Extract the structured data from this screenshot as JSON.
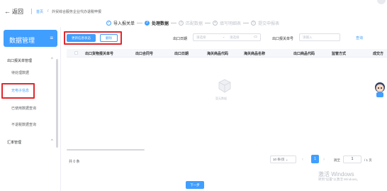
{
  "header": {
    "back_label": "返回",
    "breadcrumb_home": "首页",
    "breadcrumb_separator": "/",
    "breadcrumb_current": "外贸综合服务企业代办退税申报"
  },
  "steps": [
    {
      "number": "✓",
      "label": "导入报关单",
      "state": "done"
    },
    {
      "number": "2",
      "label": "处理数据",
      "state": "active"
    },
    {
      "number": "3",
      "label": "匹配数据",
      "state": "todo"
    },
    {
      "number": "4",
      "label": "填写明细表",
      "state": "todo"
    },
    {
      "number": "5",
      "label": "提交申报表",
      "state": "todo"
    }
  ],
  "sidebar": {
    "title": "数据管理",
    "groups": [
      {
        "label": "出口报关单管理",
        "items": [
          "待处理数据",
          "无电子信息",
          "已使用数据查询",
          "不退税数据查询"
        ]
      },
      {
        "label": "汇率管理",
        "items": []
      }
    ],
    "active_item": "无电子信息"
  },
  "toolbar": {
    "update_label": "更新信息状态",
    "delete_label": "删除"
  },
  "filters": {
    "date_label": "出口日期",
    "date_start_placeholder": "请选择",
    "date_separator": "-",
    "date_end_placeholder": "请选择",
    "declaration_label": "出口报关单号",
    "declaration_placeholder": "请输入",
    "query_label": "查询"
  },
  "table": {
    "columns": [
      "出口货物报关单号",
      "出口合同号",
      "出口日期",
      "海关商品代码",
      "海关商品名称",
      "出口商品代码",
      "监管方式",
      "成交方"
    ],
    "empty_text": "暂无数据",
    "total_text": "共 0 条"
  },
  "pagination": {
    "page_size": "10 条/页",
    "current_page": "1",
    "goto_label": "跳至",
    "goto_value": "1",
    "total_pages": "/ 1 页"
  },
  "footer": {
    "next_label": "下一步"
  },
  "watermark": {
    "line1": "激活 Windows",
    "line2": "转到\"设置\"以激活 Windows。"
  },
  "colors": {
    "primary": "#409eff",
    "highlight": "#e0282e"
  }
}
